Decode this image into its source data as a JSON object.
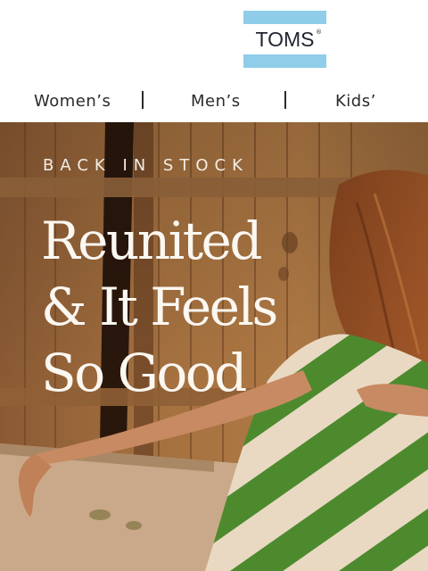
{
  "brand": {
    "logo_text": "TOMS",
    "logo_mark": "®"
  },
  "nav": {
    "items": [
      {
        "label": "Women’s"
      },
      {
        "label": "Men’s"
      },
      {
        "label": "Kids’"
      }
    ]
  },
  "hero": {
    "kicker": "BACK IN STOCK",
    "headline_lines": [
      "Reunited",
      "& It Feels",
      "So Good"
    ]
  },
  "colors": {
    "logo_stripe": "#8fcde8",
    "text_dark": "#1f2430",
    "hero_text": "#fbf7f1",
    "dress_green": "#4d8a2e",
    "dress_cream": "#e9d9c2"
  }
}
